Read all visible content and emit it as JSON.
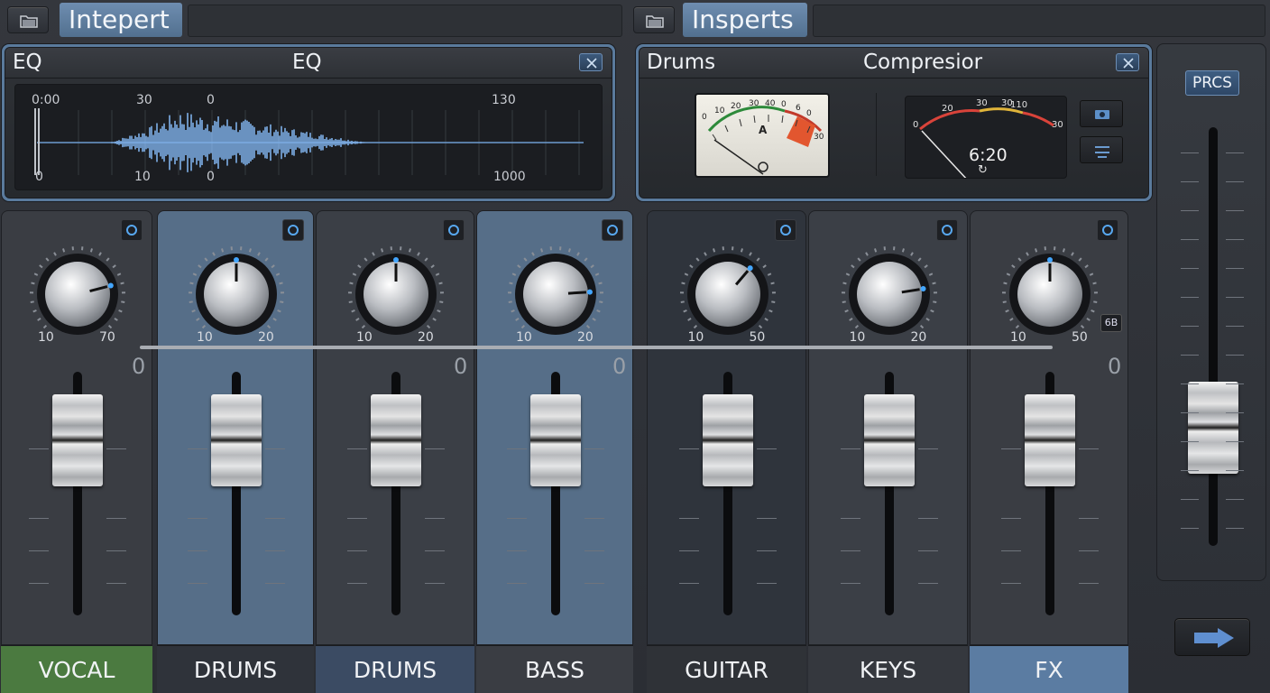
{
  "topbar": {
    "left_title": "Intepert",
    "right_title": "Insperts"
  },
  "eq_panel": {
    "title_left": "EQ",
    "title_center": "EQ",
    "labels_top": [
      "0:00",
      "30",
      "0",
      "130"
    ],
    "labels_bottom": [
      "0",
      "10",
      "0",
      "1000"
    ]
  },
  "comp_panel": {
    "title_left": "Drums",
    "title_center": "Compresior",
    "vu_meter_1": {
      "scale_labels": [
        "0",
        "10",
        "20",
        "30",
        "40",
        "0",
        "6",
        "0",
        "30"
      ],
      "mid_label": "A"
    },
    "vu_meter_2": {
      "scale_labels": [
        "0",
        "20",
        "30",
        "30",
        "110",
        "30"
      ],
      "readout": "6:20",
      "readout_symbol": "↻"
    }
  },
  "channels": [
    {
      "name": "VOCAL",
      "knob_min": "10",
      "knob_max": "70",
      "knob_value": 0.78,
      "fader_zero": "0",
      "show_zero": true,
      "bg": "#3a3d43",
      "name_bg": "#4b7a40"
    },
    {
      "name": "DRUMS",
      "knob_min": "10",
      "knob_max": "20",
      "knob_value": 0.5,
      "fader_zero": "",
      "show_zero": false,
      "bg": "#566e88",
      "name_bg": "#2f333a"
    },
    {
      "name": "DRUMS",
      "knob_min": "10",
      "knob_max": "20",
      "knob_value": 0.5,
      "fader_zero": "0",
      "show_zero": true,
      "bg": "#3b3f46",
      "name_bg": "#3b4b63"
    },
    {
      "name": "BASS",
      "knob_min": "10",
      "knob_max": "20",
      "knob_value": 0.82,
      "fader_zero": "0",
      "show_zero": true,
      "bg": "#566e88",
      "name_bg": "#3a3d43"
    },
    {
      "name": "GUITAR",
      "knob_min": "10",
      "knob_max": "50",
      "knob_value": 0.65,
      "fader_zero": "",
      "show_zero": false,
      "bg": "#2f343c",
      "name_bg": "#2f3237"
    },
    {
      "name": "KEYS",
      "knob_min": "10",
      "knob_max": "20",
      "knob_value": 0.8,
      "fader_zero": "",
      "show_zero": false,
      "bg": "#3b3f46",
      "name_bg": "#35383e"
    },
    {
      "name": "FX",
      "knob_min": "10",
      "knob_max": "50",
      "knob_value": 0.5,
      "fader_zero": "0",
      "show_zero": true,
      "bg": "#3a3d43",
      "name_bg": "#5b7ca2",
      "badge": "6B"
    }
  ],
  "side": {
    "prcs_label": "PRCS"
  },
  "colors": {
    "accent": "#5f7fa3",
    "knob_indicator": "#43a6ff"
  },
  "icons": {
    "folder": "folder-icon",
    "close": "close-icon",
    "power": "power-icon",
    "arrow": "arrow-right-icon",
    "camera": "camera-icon",
    "list": "list-icon"
  }
}
